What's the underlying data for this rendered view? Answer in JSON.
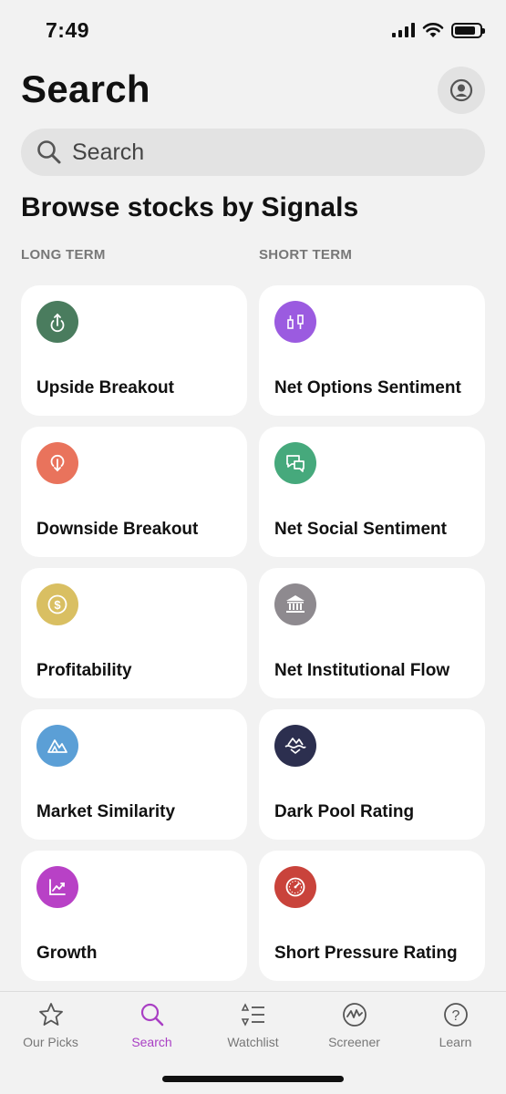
{
  "status_bar": {
    "time": "7:49"
  },
  "header": {
    "title": "Search"
  },
  "search": {
    "placeholder": "Search"
  },
  "section": {
    "title": "Browse stocks by Signals",
    "long_term_label": "LONG TERM",
    "short_term_label": "SHORT TERM"
  },
  "long_term": [
    {
      "label": "Upside Breakout",
      "icon": "upside-arrow-icon",
      "color": "#4a7c5e"
    },
    {
      "label": "Downside Breakout",
      "icon": "downside-arrow-icon",
      "color": "#e9735c"
    },
    {
      "label": "Profitability",
      "icon": "dollar-coin-icon",
      "color": "#d9bf62"
    },
    {
      "label": "Market Similarity",
      "icon": "mountains-icon",
      "color": "#5b9fd6"
    },
    {
      "label": "Growth",
      "icon": "trend-chart-icon",
      "color": "#b841c6"
    }
  ],
  "short_term": [
    {
      "label": "Net Options Sentiment",
      "icon": "sliders-icon",
      "color": "#9b5be0"
    },
    {
      "label": "Net Social Sentiment",
      "icon": "chat-bubbles-icon",
      "color": "#46a97c"
    },
    {
      "label": "Net Institutional Flow",
      "icon": "bank-icon",
      "color": "#8e8a8f"
    },
    {
      "label": "Dark Pool Rating",
      "icon": "waves-icon",
      "color": "#2c2f4f"
    },
    {
      "label": "Short Pressure Rating",
      "icon": "gauge-icon",
      "color": "#c9433b"
    }
  ],
  "tabs": [
    {
      "label": "Our Picks",
      "icon": "star-icon",
      "active": false
    },
    {
      "label": "Search",
      "icon": "search-icon",
      "active": true
    },
    {
      "label": "Watchlist",
      "icon": "list-icon",
      "active": false
    },
    {
      "label": "Screener",
      "icon": "screener-icon",
      "active": false
    },
    {
      "label": "Learn",
      "icon": "question-icon",
      "active": false
    }
  ],
  "colors": {
    "accent": "#a93fc4",
    "background": "#f2f2f2",
    "card": "#ffffff"
  }
}
